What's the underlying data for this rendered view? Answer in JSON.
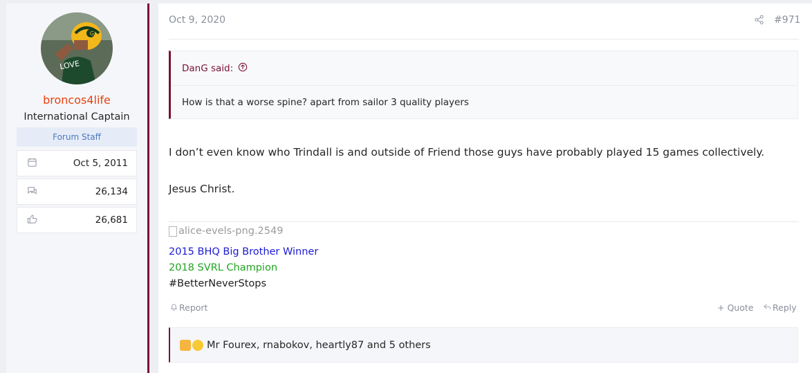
{
  "user": {
    "name": "broncos4life",
    "title": "International Captain",
    "banner": "Forum Staff",
    "joined": "Oct 5, 2011",
    "messages": "26,134",
    "reactions": "26,681"
  },
  "post": {
    "date": "Oct 9, 2020",
    "number": "#971",
    "quote": {
      "author": "DanG said:",
      "text": "How is that a worse spine? apart from sailor 3 quality players"
    },
    "body": [
      "I don’t even know who Trindall is and outside of Friend those guys have probably played 15 games collectively.",
      "Jesus Christ."
    ],
    "signature": {
      "image_alt": "alice-evels-png.2549",
      "lines": [
        {
          "text": "2015 BHQ Big Brother Winner",
          "color": "#1a1ad6"
        },
        {
          "text": "2018 SVRL Champion",
          "color": "#1fa51f"
        },
        {
          "text": "#BetterNeverStops",
          "color": "#1e1e1e"
        }
      ]
    },
    "actions": {
      "report": "Report",
      "quote": "+ Quote",
      "reply": "Reply"
    },
    "reactions_text": "Mr Fourex, rnabokov, heartly87 and 5 others"
  },
  "colors": {
    "accent": "#7b1133",
    "username": "#e8420e",
    "muted": "#8a8f9a"
  }
}
